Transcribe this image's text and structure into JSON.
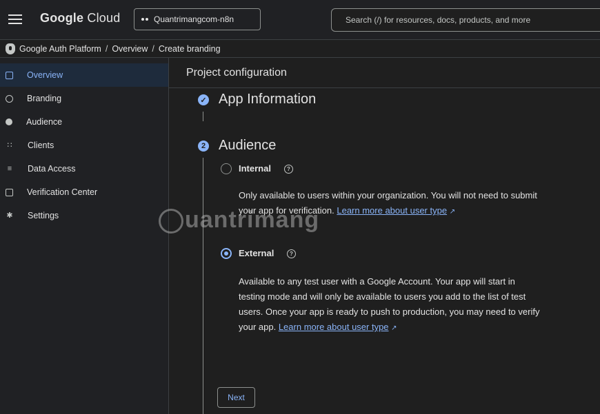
{
  "topbar": {
    "brand_google": "Google",
    "brand_cloud": "Cloud",
    "project_name": "Quantrimangcom-n8n",
    "search_placeholder": "Search (/) for resources, docs, products, and more"
  },
  "breadcrumb": {
    "items": [
      "Google Auth Platform",
      "Overview",
      "Create branding"
    ],
    "separator": "/"
  },
  "sidebar": {
    "items": [
      {
        "label": "Overview",
        "icon": "dashboard-icon",
        "active": true
      },
      {
        "label": "Branding",
        "icon": "palette-icon"
      },
      {
        "label": "Audience",
        "icon": "person-icon"
      },
      {
        "label": "Clients",
        "icon": "grid-icon"
      },
      {
        "label": "Data Access",
        "icon": "data-access-icon"
      },
      {
        "label": "Verification Center",
        "icon": "checkbox-icon"
      },
      {
        "label": "Settings",
        "icon": "gear-icon"
      }
    ]
  },
  "main": {
    "header": "Project configuration",
    "steps": [
      {
        "title": "App Information",
        "status": "completed"
      },
      {
        "title": "Audience",
        "number": "2",
        "status": "current"
      }
    ],
    "options": [
      {
        "label": "Internal",
        "selected": false,
        "description": "Only available to users within your organization. You will not need to submit your app for verification.",
        "link": "Learn more about user type"
      },
      {
        "label": "External",
        "selected": true,
        "description": "Available to any test user with a Google Account. Your app will start in testing mode and will only be available to users you add to the list of test users. Once your app is ready to push to production, you may need to verify your app.",
        "link": "Learn more about user type"
      }
    ],
    "next_label": "Next"
  },
  "watermark": "uantrimang",
  "colors": {
    "accent": "#8ab4f8",
    "background": "#1f1f1f",
    "sidebar_active": "#1e2b3c"
  }
}
